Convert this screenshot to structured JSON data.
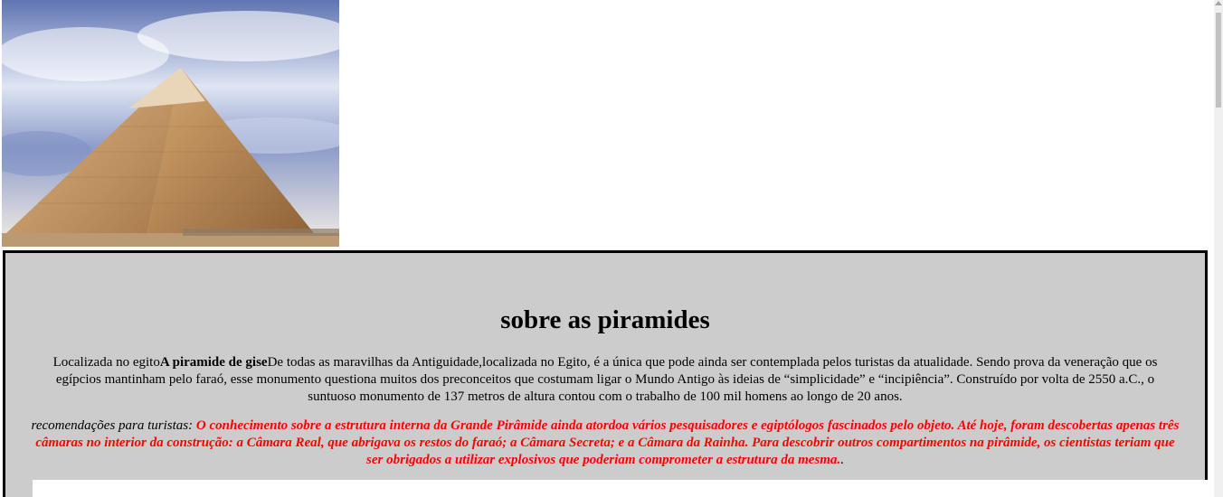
{
  "hero_image": {
    "alt": "pyramid-photo",
    "sky_colors": [
      "#6c7fb8",
      "#d9e0f0",
      "#ffffff"
    ],
    "stone_color": "#c89a5e"
  },
  "section": {
    "title": "sobre as piramides",
    "intro_prefix": "Localizada no egito",
    "intro_bold": "A piramide de gise",
    "intro_text": "De todas as maravilhas da Antiguidade,localizada no Egito, é a única que pode ainda ser contemplada pelos turistas da atualidade. Sendo prova da veneração que os egípcios mantinham pelo faraó, esse monumento questiona muitos dos preconceitos que costumam ligar o Mundo Antigo às ideias de “simplicidade” e “incipiência”. Construído por volta de 2550 a.C., o suntuoso monumento de 137 metros de altura contou com o trabalho de 100 mil homens ao longo de 20 anos.",
    "tips_label": "recomendações para turistas:",
    "tips_text": "O conhecimento sobre a estrutura interna da Grande Pirâmide ainda atordoa vários pesquisadores e egiptólogos fascinados pelo objeto. Até hoje, foram descobertas apenas três câmaras no interior da construção: a Câmara Real, que abrigava os restos do faraó; a Câmara Secreta; e a Câmara da Rainha. Para descobrir outros compartimentos na pirâmide, os cientistas teriam que ser obrigados a utilizar explosivos que poderiam comprometer a estrutura da mesma.",
    "tips_suffix": ".",
    "accent_color": "#ff0000",
    "box_background": "#cccccc"
  }
}
